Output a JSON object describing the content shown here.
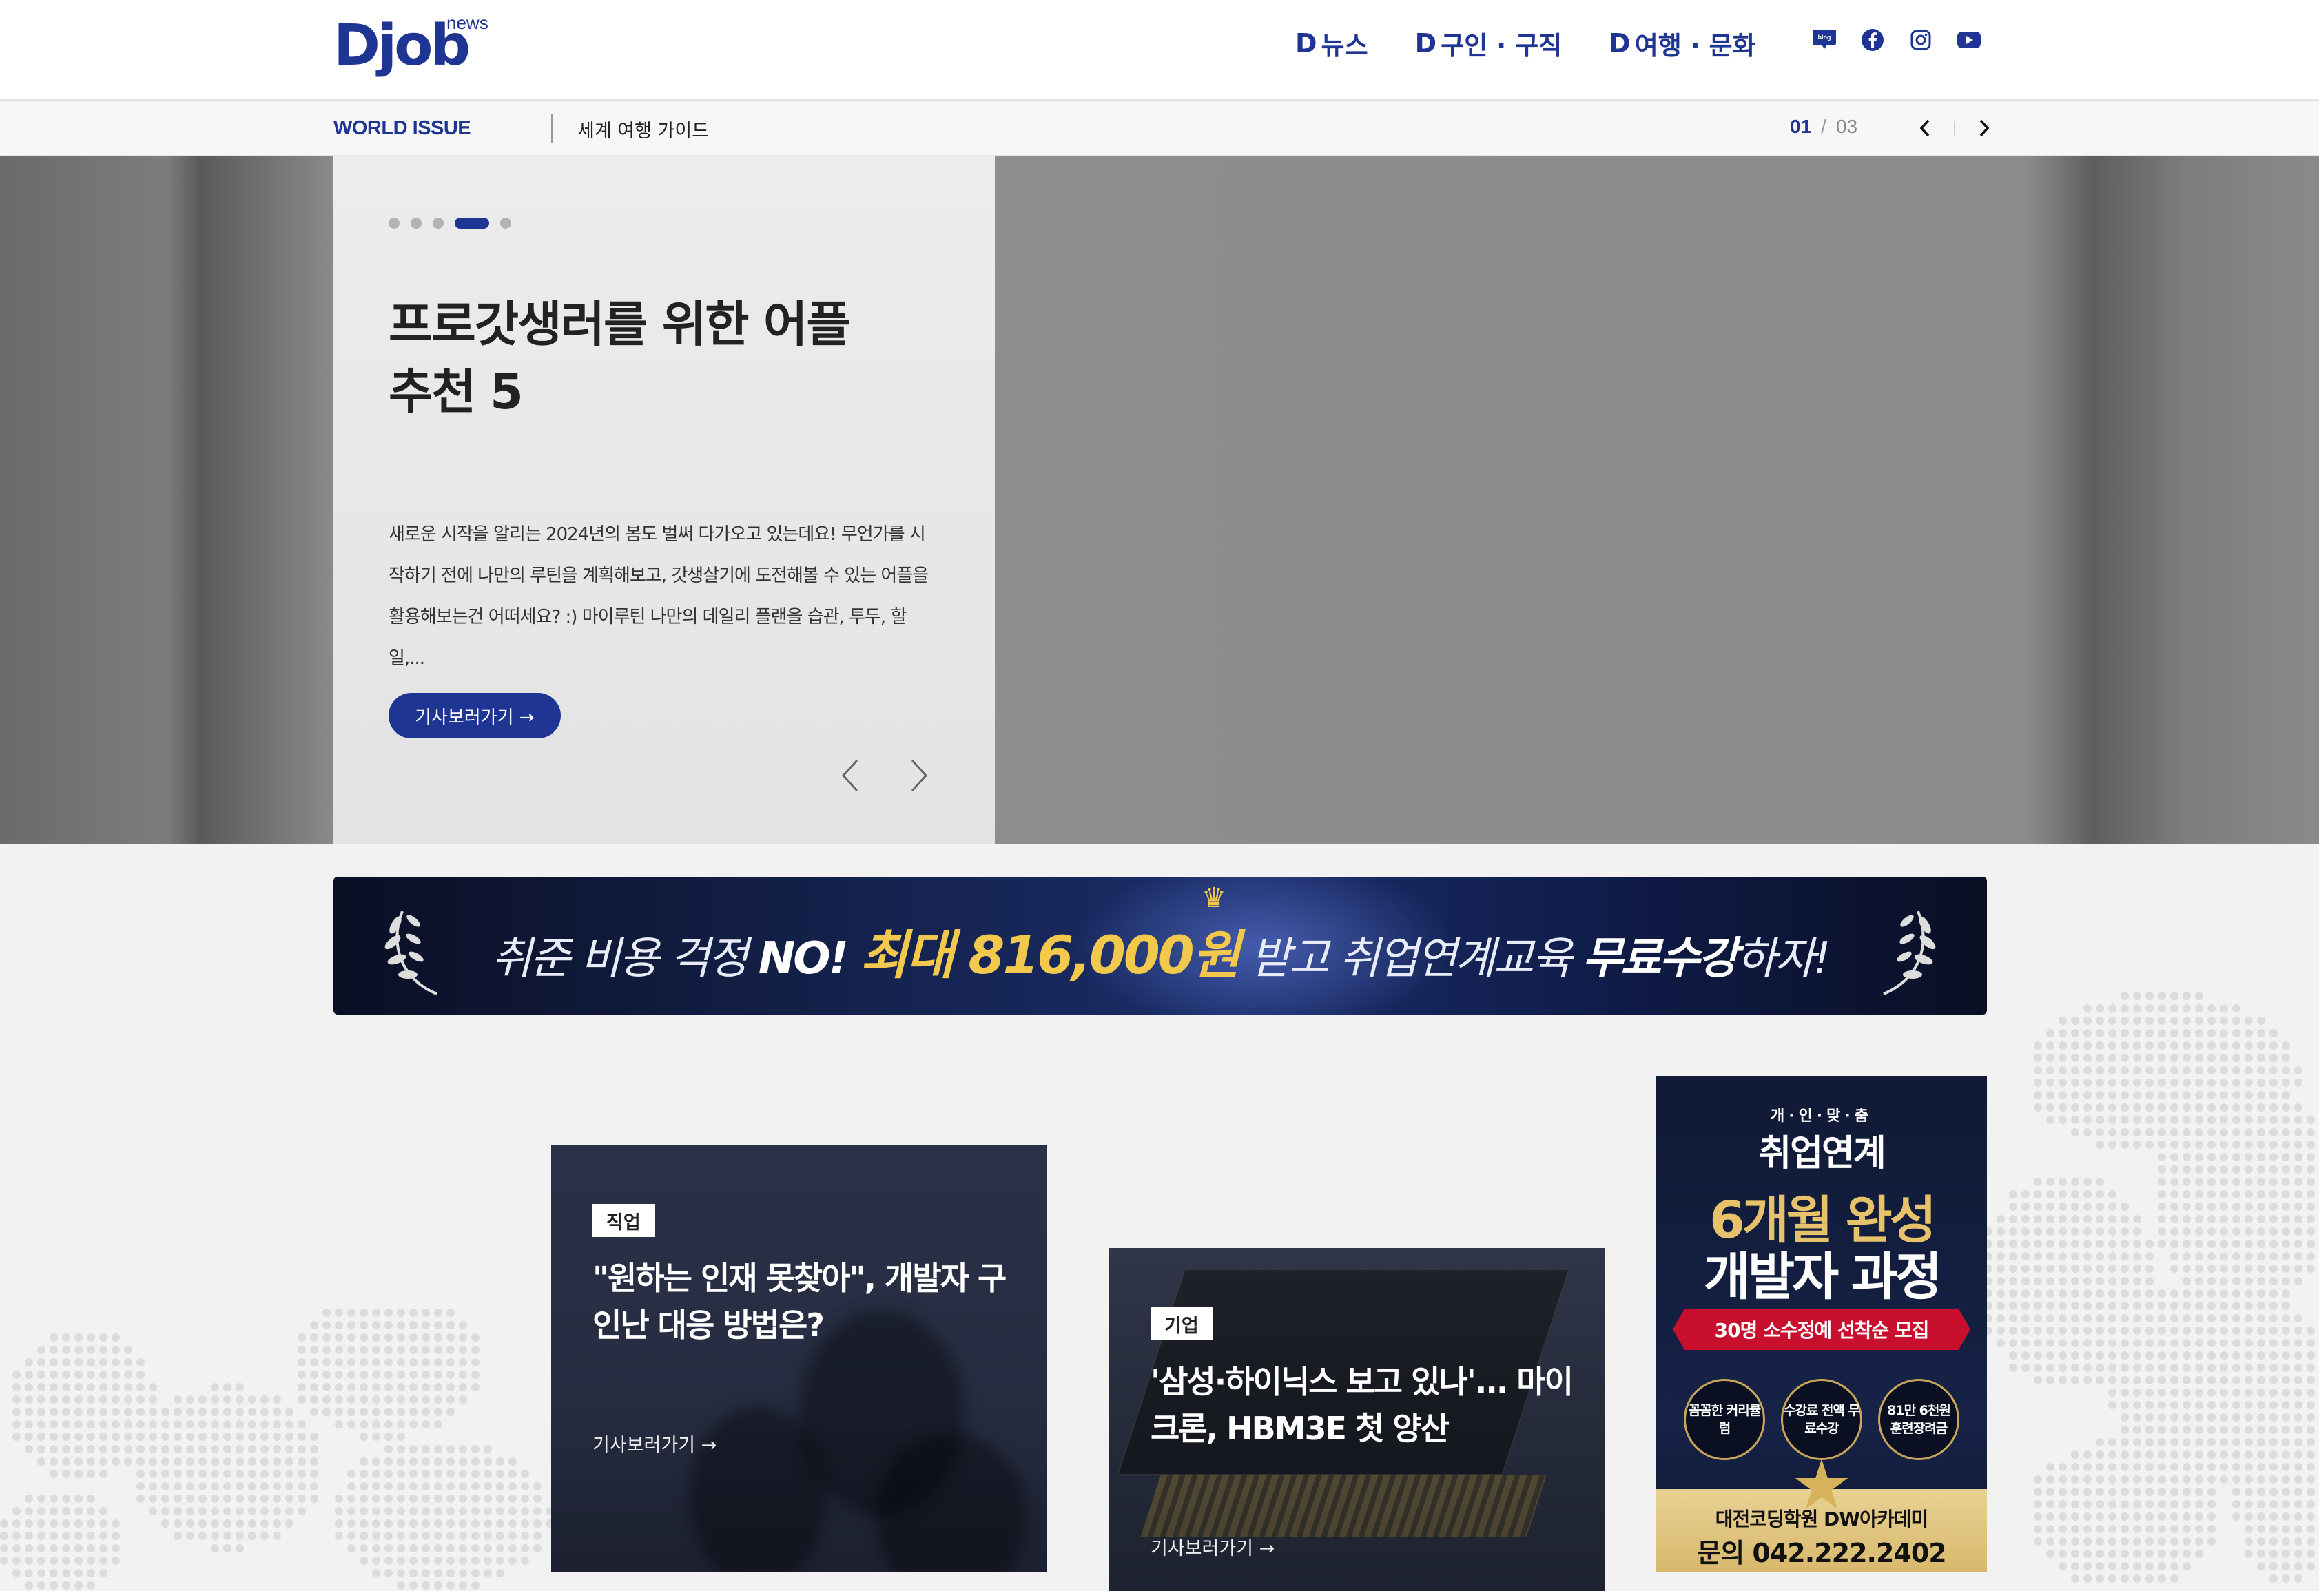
{
  "header": {
    "logo_main": "Djob",
    "logo_sub": "news",
    "nav": [
      {
        "prefix": "D",
        "label": "뉴스"
      },
      {
        "prefix": "D",
        "label": "구인 · 구직"
      },
      {
        "prefix": "D",
        "label": "여행 · 문화"
      }
    ],
    "sns": [
      "blog-icon",
      "facebook-icon",
      "instagram-icon",
      "youtube-icon"
    ],
    "sns_blog_text": "blog"
  },
  "subbar": {
    "category": "WORLD ISSUE",
    "title": "세계 여행 가이드",
    "pager_current": "01",
    "pager_sep": "/",
    "pager_total": "03"
  },
  "hero": {
    "active_dot": 4,
    "dot_count": 5,
    "title_line1": "프로갓생러를 위한 어플",
    "title_line2": "추천 5",
    "desc": "새로운 시작을 알리는 2024년의 봄도 벌써 다가오고 있는데요! 무언가를 시작하기 전에 나만의 루틴을 계획해보고, 갓생살기에 도전해볼 수 있는 어플을 활용해보는건 어떠세요? :) 마이루틴 나만의 데일리 플랜을 습관, 투두, 할일,...",
    "button_label": "기사보러가기 →"
  },
  "banner": {
    "part1": "취준 비용 걱정 ",
    "part2": "NO! ",
    "part3": "최대 816,000원",
    "part4": " 받고 취업연계교육 ",
    "part5": "무료수강",
    "part6": "하자!"
  },
  "cards": [
    {
      "tag": "직업",
      "title": "\"원하는 인재 못찾아\", 개발자 구인난 대응 방법은?",
      "link": "기사보러가기 →"
    },
    {
      "tag": "기업",
      "title": "'삼성·하이닉스 보고 있나'... 마이크론, HBM3E 첫 양산",
      "link": "기사보러가기 →"
    }
  ],
  "side_ad": {
    "kicker": "개·인·맞·춤",
    "head": "취업연계",
    "big1": "6개월 완성",
    "big2": "개발자 과정",
    "ribbon": "30명 소수정예 선착순 모집",
    "circles": [
      "꼼꼼한 커리큘럼",
      "수강료 전액 무료수강",
      "81만 6천원 훈련장려금"
    ],
    "academy": "대전코딩학원 DW아카데미",
    "phone": "문의 042.222.2402"
  },
  "colors": {
    "brand": "#1f3593",
    "accent_gold": "#f2c94c"
  }
}
